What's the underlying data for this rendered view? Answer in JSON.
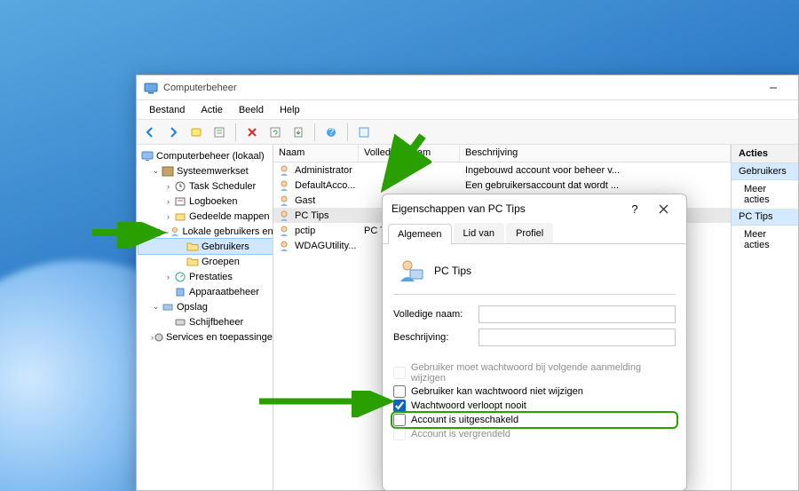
{
  "window": {
    "title": "Computerbeheer",
    "menus": [
      "Bestand",
      "Actie",
      "Beeld",
      "Help"
    ]
  },
  "toolbar": {
    "buttons": [
      "back",
      "forward",
      "up",
      "properties",
      "delete",
      "refresh",
      "export",
      "help",
      "sep",
      "view"
    ]
  },
  "tree": {
    "root": "Computerbeheer (lokaal)",
    "items": [
      {
        "label": "Systeemwerkset",
        "level": 1,
        "expand": "open",
        "icon": "tools"
      },
      {
        "label": "Task Scheduler",
        "level": 2,
        "expand": "closed",
        "icon": "clock"
      },
      {
        "label": "Logboeken",
        "level": 2,
        "expand": "closed",
        "icon": "event"
      },
      {
        "label": "Gedeelde mappen",
        "level": 2,
        "expand": "closed",
        "icon": "share"
      },
      {
        "label": "Lokale gebruikers en gro",
        "level": 2,
        "expand": "open",
        "icon": "users"
      },
      {
        "label": "Gebruikers",
        "level": 3,
        "expand": "none",
        "icon": "folder",
        "selected": true
      },
      {
        "label": "Groepen",
        "level": 3,
        "expand": "none",
        "icon": "folder"
      },
      {
        "label": "Prestaties",
        "level": 2,
        "expand": "closed",
        "icon": "perf"
      },
      {
        "label": "Apparaatbeheer",
        "level": 2,
        "expand": "none",
        "icon": "device"
      },
      {
        "label": "Opslag",
        "level": 1,
        "expand": "open",
        "icon": "storage"
      },
      {
        "label": "Schijfbeheer",
        "level": 2,
        "expand": "none",
        "icon": "disk"
      },
      {
        "label": "Services en toepassingen",
        "level": 1,
        "expand": "closed",
        "icon": "services"
      }
    ]
  },
  "list": {
    "columns": {
      "name": "Naam",
      "full": "Volledige naam",
      "desc": "Beschrijving"
    },
    "rows": [
      {
        "name": "Administrator",
        "full": "",
        "desc": "Ingebouwd account voor beheer v..."
      },
      {
        "name": "DefaultAcco...",
        "full": "",
        "desc": "Een gebruikersaccount dat wordt ..."
      },
      {
        "name": "Gast",
        "full": "",
        "desc": ""
      },
      {
        "name": "PC Tips",
        "full": "",
        "desc": "",
        "selected": true
      },
      {
        "name": "pctip",
        "full": "PC Tips",
        "desc": ""
      },
      {
        "name": "WDAGUtility...",
        "full": "",
        "desc": ""
      }
    ]
  },
  "actions": {
    "header": "Acties",
    "groups": [
      {
        "title": "Gebruikers",
        "items": [
          "Meer acties"
        ]
      },
      {
        "title": "PC Tips",
        "items": [
          "Meer acties"
        ]
      }
    ]
  },
  "dialog": {
    "title": "Eigenschappen van PC Tips",
    "tabs": [
      "Algemeen",
      "Lid van",
      "Profiel"
    ],
    "user_name": "PC Tips",
    "labels": {
      "full": "Volledige naam:",
      "desc": "Beschrijving:"
    },
    "fields": {
      "full": "",
      "desc": ""
    },
    "checkboxes": [
      {
        "label": "Gebruiker moet wachtwoord bij volgende aanmelding wijzigen",
        "checked": false,
        "disabled": true
      },
      {
        "label": "Gebruiker kan wachtwoord niet wijzigen",
        "checked": false,
        "disabled": false
      },
      {
        "label": "Wachtwoord verloopt nooit",
        "checked": true,
        "disabled": false
      },
      {
        "label": "Account is uitgeschakeld",
        "checked": false,
        "disabled": false,
        "highlight": true
      },
      {
        "label": "Account is vergrendeld",
        "checked": false,
        "disabled": true
      }
    ]
  }
}
